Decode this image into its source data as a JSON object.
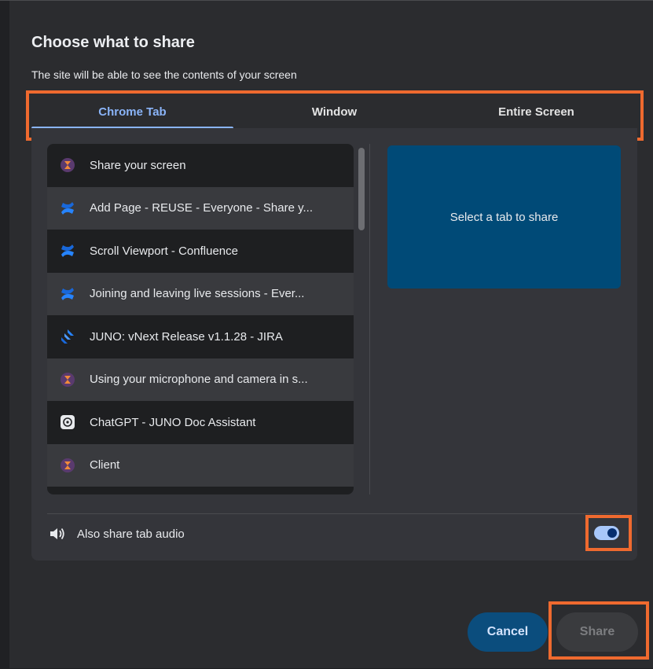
{
  "dialog": {
    "title": "Choose what to share",
    "subtitle": "The site will be able to see the contents of your screen"
  },
  "tabs": [
    {
      "label": "Chrome Tab",
      "active": true
    },
    {
      "label": "Window",
      "active": false
    },
    {
      "label": "Entire Screen",
      "active": false
    }
  ],
  "tab_list": [
    {
      "label": "Share your screen",
      "icon": "juno-avatar-icon"
    },
    {
      "label": "Add Page - REUSE - Everyone - Share y...",
      "icon": "confluence-icon"
    },
    {
      "label": "Scroll Viewport - Confluence",
      "icon": "confluence-icon"
    },
    {
      "label": "Joining and leaving live sessions - Ever...",
      "icon": "confluence-icon"
    },
    {
      "label": "JUNO: vNext Release v1.1.28 - JIRA",
      "icon": "jira-icon"
    },
    {
      "label": "Using your microphone and camera in s...",
      "icon": "juno-avatar-icon"
    },
    {
      "label": "ChatGPT - JUNO Doc Assistant",
      "icon": "chatgpt-icon"
    },
    {
      "label": "Client",
      "icon": "juno-avatar-icon"
    }
  ],
  "preview": {
    "placeholder": "Select a tab to share"
  },
  "audio": {
    "label": "Also share tab audio",
    "enabled": true
  },
  "buttons": {
    "cancel": "Cancel",
    "share": "Share"
  },
  "colors": {
    "accent": "#8ab4f8",
    "preview_bg": "#004a77",
    "highlight": "#ef6a2f",
    "cancel_bg": "#0b4d7d"
  }
}
